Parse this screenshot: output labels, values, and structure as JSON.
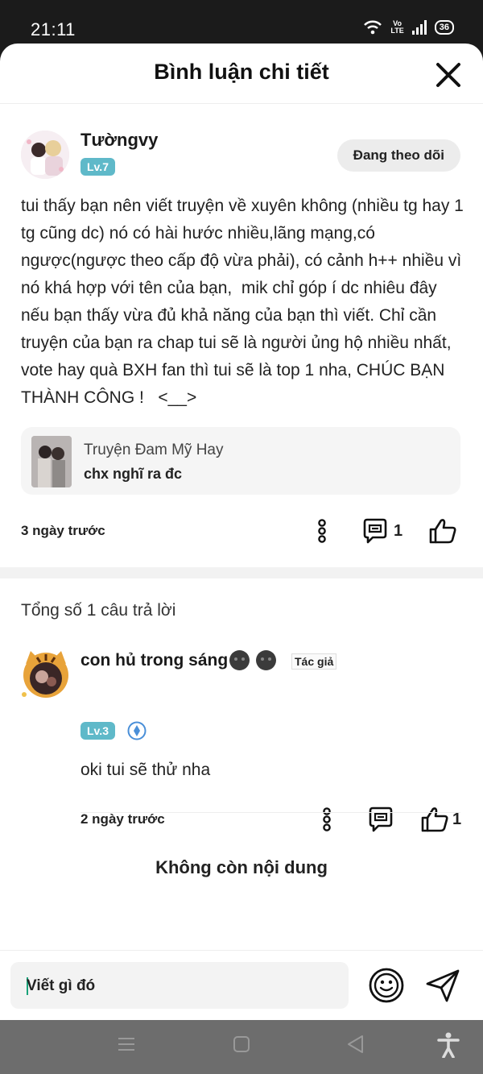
{
  "status_bar": {
    "time": "21:11",
    "network": "Vo LTE",
    "battery": "36"
  },
  "header": {
    "title": "Bình luận chi tiết"
  },
  "comment": {
    "username": "Tườngvy",
    "level": "Lv.7",
    "follow_label": "Đang theo dõi",
    "text": "tui thấy bạn nên viết truyện về xuyên không (nhiều tg hay 1 tg cũng dc) nó có hài hước nhiều,lãng mạng,có ngược(ngược theo cấp độ vừa phải), có cảnh h++ nhiều vì nó khá hợp với tên của bạn,  mik chỉ góp í dc nhiêu đây nếu bạn thấy vừa đủ khả năng của bạn thì viết. Chỉ cần truyện của bạn ra chap tui sẽ là người ủng hộ nhiều nhất, vote hay quà BXH fan thì tui sẽ là top 1 nha, CHÚC BẠN THÀNH CÔNG !   <__>",
    "story": {
      "title": "Truyện Đam Mỹ Hay",
      "subtitle": "chx nghĩ ra đc"
    },
    "time": "3 ngày trước",
    "reply_count": "1"
  },
  "replies": {
    "title": "Tổng số 1 câu trả lời",
    "items": [
      {
        "username": "con hủ trong sáng",
        "level": "Lv.3",
        "badge": "Tác giả",
        "text": "oki tui sẽ thử nha",
        "time": "2 ngày trước",
        "like_count": "1"
      }
    ],
    "empty_text": "Không còn nội dung"
  },
  "input": {
    "placeholder": "Viết gì đó"
  },
  "colors": {
    "level_badge": "#5fb9c9",
    "verified": "#4a8fd8",
    "cursor": "#1aa37a"
  },
  "icons": [
    "wifi-icon",
    "signal-icon",
    "battery-icon",
    "close-icon",
    "more-vertical-icon",
    "reply-icon",
    "thumbs-up-icon",
    "verified-icon",
    "emoji-icon",
    "send-icon",
    "menu-icon",
    "home-icon",
    "back-icon",
    "accessibility-icon"
  ]
}
